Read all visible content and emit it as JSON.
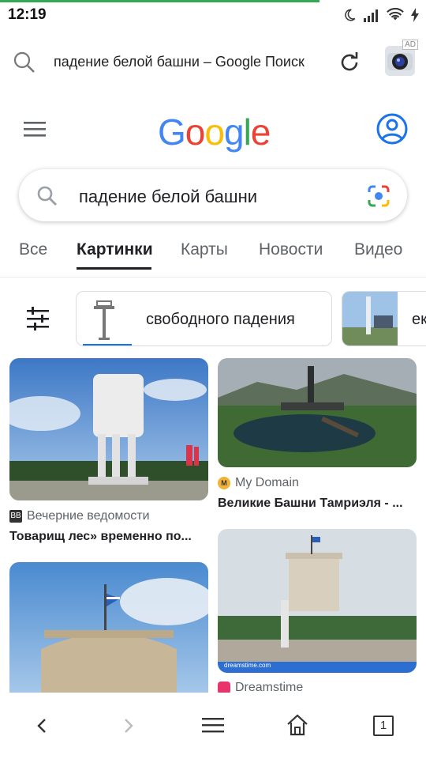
{
  "status_bar": {
    "time": "12:19"
  },
  "browser": {
    "url_text": "падение белой башни – Google Поиск",
    "ad_badge": "AD"
  },
  "google": {
    "logo_letters": [
      "G",
      "o",
      "o",
      "g",
      "l",
      "e"
    ],
    "logo_colors": [
      "#4285F4",
      "#EA4335",
      "#FBBC05",
      "#4285F4",
      "#34A853",
      "#EA4335"
    ],
    "search_query": "падение белой башни"
  },
  "tabs": [
    {
      "label": "Все",
      "active": false
    },
    {
      "label": "Картинки",
      "active": true
    },
    {
      "label": "Карты",
      "active": false
    },
    {
      "label": "Новости",
      "active": false
    },
    {
      "label": "Видео",
      "active": false
    }
  ],
  "chips": [
    {
      "label": "свободного падения"
    },
    {
      "label": "ек"
    }
  ],
  "results": [
    {
      "source": "Вечерние ведомости",
      "title": "Товарищ лес» временно по..."
    },
    {
      "source": "My Domain",
      "title": "Великие Башни Тамриэля - ..."
    },
    {
      "source": "",
      "title": ""
    },
    {
      "source": "Dreamstime",
      "title": "",
      "watermark": "dreamstime.com"
    }
  ],
  "bottom_nav": {
    "tab_count": "1"
  },
  "colors": {
    "accent_green": "#34a853",
    "google_blue": "#4285F4"
  }
}
